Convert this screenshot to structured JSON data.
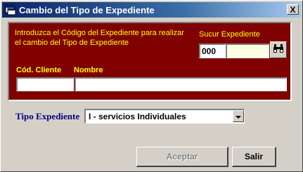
{
  "window": {
    "title": "Cambio del Tipo de Expediente",
    "close_label": "X"
  },
  "panel": {
    "instruction": "Introduzca el Código del Expediente para realizar el cambio del Tipo de Expediente",
    "sucur_label": "Sucur Expediente",
    "sucur_code": "000",
    "expediente_value": "",
    "col_cliente_label": "Cód. Cliente",
    "col_nombre_label": "Nombre",
    "cliente_value": "",
    "nombre_value": ""
  },
  "tipo": {
    "label": "Tipo Expediente",
    "selected": "I - servicios Individuales"
  },
  "buttons": {
    "aceptar": "Aceptar",
    "salir": "Salir"
  },
  "colors": {
    "panel_bg": "#800000",
    "panel_text": "#ffff00",
    "title_bar": "#0a246a"
  },
  "icons": {
    "app": "app-window-icon",
    "search": "binoculars-icon",
    "dropdown": "chevron-down-icon"
  }
}
